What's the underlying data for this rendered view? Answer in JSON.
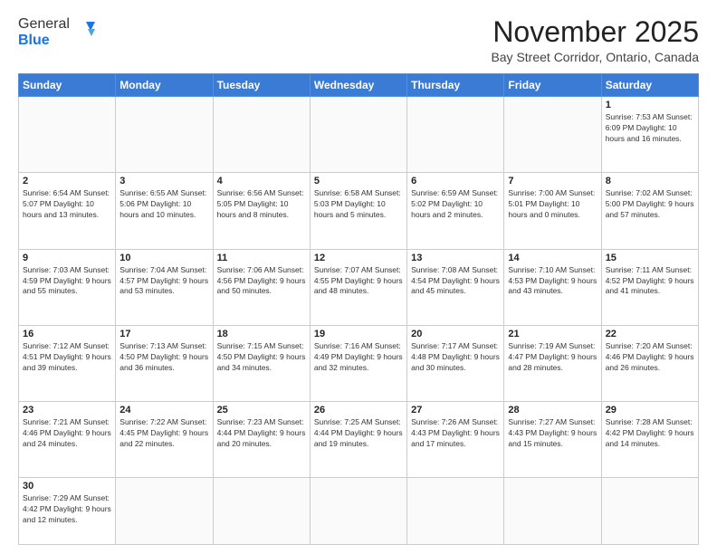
{
  "header": {
    "logo_general": "General",
    "logo_blue": "Blue",
    "month_title": "November 2025",
    "location": "Bay Street Corridor, Ontario, Canada"
  },
  "days_of_week": [
    "Sunday",
    "Monday",
    "Tuesday",
    "Wednesday",
    "Thursday",
    "Friday",
    "Saturday"
  ],
  "weeks": [
    [
      {
        "day": "",
        "info": ""
      },
      {
        "day": "",
        "info": ""
      },
      {
        "day": "",
        "info": ""
      },
      {
        "day": "",
        "info": ""
      },
      {
        "day": "",
        "info": ""
      },
      {
        "day": "",
        "info": ""
      },
      {
        "day": "1",
        "info": "Sunrise: 7:53 AM\nSunset: 6:09 PM\nDaylight: 10 hours and 16 minutes."
      }
    ],
    [
      {
        "day": "2",
        "info": "Sunrise: 6:54 AM\nSunset: 5:07 PM\nDaylight: 10 hours and 13 minutes."
      },
      {
        "day": "3",
        "info": "Sunrise: 6:55 AM\nSunset: 5:06 PM\nDaylight: 10 hours and 10 minutes."
      },
      {
        "day": "4",
        "info": "Sunrise: 6:56 AM\nSunset: 5:05 PM\nDaylight: 10 hours and 8 minutes."
      },
      {
        "day": "5",
        "info": "Sunrise: 6:58 AM\nSunset: 5:03 PM\nDaylight: 10 hours and 5 minutes."
      },
      {
        "day": "6",
        "info": "Sunrise: 6:59 AM\nSunset: 5:02 PM\nDaylight: 10 hours and 2 minutes."
      },
      {
        "day": "7",
        "info": "Sunrise: 7:00 AM\nSunset: 5:01 PM\nDaylight: 10 hours and 0 minutes."
      },
      {
        "day": "8",
        "info": "Sunrise: 7:02 AM\nSunset: 5:00 PM\nDaylight: 9 hours and 57 minutes."
      }
    ],
    [
      {
        "day": "9",
        "info": "Sunrise: 7:03 AM\nSunset: 4:59 PM\nDaylight: 9 hours and 55 minutes."
      },
      {
        "day": "10",
        "info": "Sunrise: 7:04 AM\nSunset: 4:57 PM\nDaylight: 9 hours and 53 minutes."
      },
      {
        "day": "11",
        "info": "Sunrise: 7:06 AM\nSunset: 4:56 PM\nDaylight: 9 hours and 50 minutes."
      },
      {
        "day": "12",
        "info": "Sunrise: 7:07 AM\nSunset: 4:55 PM\nDaylight: 9 hours and 48 minutes."
      },
      {
        "day": "13",
        "info": "Sunrise: 7:08 AM\nSunset: 4:54 PM\nDaylight: 9 hours and 45 minutes."
      },
      {
        "day": "14",
        "info": "Sunrise: 7:10 AM\nSunset: 4:53 PM\nDaylight: 9 hours and 43 minutes."
      },
      {
        "day": "15",
        "info": "Sunrise: 7:11 AM\nSunset: 4:52 PM\nDaylight: 9 hours and 41 minutes."
      }
    ],
    [
      {
        "day": "16",
        "info": "Sunrise: 7:12 AM\nSunset: 4:51 PM\nDaylight: 9 hours and 39 minutes."
      },
      {
        "day": "17",
        "info": "Sunrise: 7:13 AM\nSunset: 4:50 PM\nDaylight: 9 hours and 36 minutes."
      },
      {
        "day": "18",
        "info": "Sunrise: 7:15 AM\nSunset: 4:50 PM\nDaylight: 9 hours and 34 minutes."
      },
      {
        "day": "19",
        "info": "Sunrise: 7:16 AM\nSunset: 4:49 PM\nDaylight: 9 hours and 32 minutes."
      },
      {
        "day": "20",
        "info": "Sunrise: 7:17 AM\nSunset: 4:48 PM\nDaylight: 9 hours and 30 minutes."
      },
      {
        "day": "21",
        "info": "Sunrise: 7:19 AM\nSunset: 4:47 PM\nDaylight: 9 hours and 28 minutes."
      },
      {
        "day": "22",
        "info": "Sunrise: 7:20 AM\nSunset: 4:46 PM\nDaylight: 9 hours and 26 minutes."
      }
    ],
    [
      {
        "day": "23",
        "info": "Sunrise: 7:21 AM\nSunset: 4:46 PM\nDaylight: 9 hours and 24 minutes."
      },
      {
        "day": "24",
        "info": "Sunrise: 7:22 AM\nSunset: 4:45 PM\nDaylight: 9 hours and 22 minutes."
      },
      {
        "day": "25",
        "info": "Sunrise: 7:23 AM\nSunset: 4:44 PM\nDaylight: 9 hours and 20 minutes."
      },
      {
        "day": "26",
        "info": "Sunrise: 7:25 AM\nSunset: 4:44 PM\nDaylight: 9 hours and 19 minutes."
      },
      {
        "day": "27",
        "info": "Sunrise: 7:26 AM\nSunset: 4:43 PM\nDaylight: 9 hours and 17 minutes."
      },
      {
        "day": "28",
        "info": "Sunrise: 7:27 AM\nSunset: 4:43 PM\nDaylight: 9 hours and 15 minutes."
      },
      {
        "day": "29",
        "info": "Sunrise: 7:28 AM\nSunset: 4:42 PM\nDaylight: 9 hours and 14 minutes."
      }
    ],
    [
      {
        "day": "30",
        "info": "Sunrise: 7:29 AM\nSunset: 4:42 PM\nDaylight: 9 hours and 12 minutes."
      },
      {
        "day": "",
        "info": ""
      },
      {
        "day": "",
        "info": ""
      },
      {
        "day": "",
        "info": ""
      },
      {
        "day": "",
        "info": ""
      },
      {
        "day": "",
        "info": ""
      },
      {
        "day": "",
        "info": ""
      }
    ]
  ]
}
